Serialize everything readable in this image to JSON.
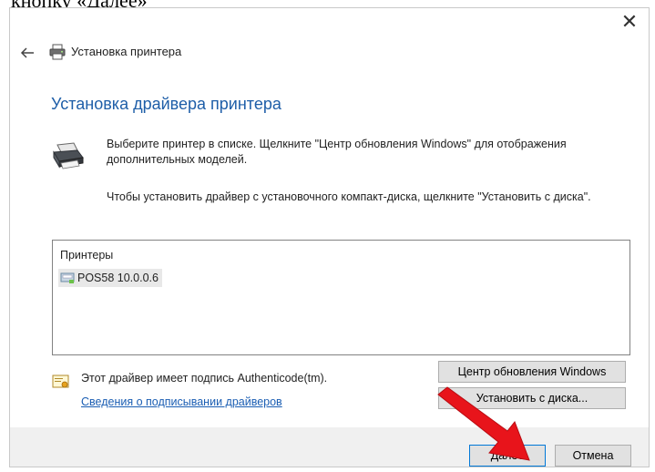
{
  "caption": {
    "text": "кнопку «Далее»"
  },
  "window": {
    "close_label": "✕",
    "back_label": "←",
    "header_title": "Установка принтера",
    "page_title": "Установка драйвера принтера",
    "description_1": "Выберите принтер в списке. Щелкните \"Центр обновления Windows\" для отображения дополнительных моделей.",
    "description_2": "Чтобы установить драйвер с установочного компакт-диска, щелкните \"Установить с диска\"."
  },
  "printer_list": {
    "header": "Принтеры",
    "items": [
      {
        "label": "POS58 10.0.0.6",
        "selected": true
      }
    ]
  },
  "signature": {
    "text": "Этот драйвер имеет подпись Authenticode(tm).",
    "link": "Сведения о подписывании драйверов"
  },
  "buttons": {
    "windows_update": "Центр обновления Windows",
    "have_disk": "Установить с диска...",
    "next": "Далее",
    "cancel": "Отмена"
  },
  "icons": {
    "back": "back-arrow-icon",
    "printer": "printer-icon",
    "certificate": "certificate-icon",
    "annotation": "red-arrow-icon"
  },
  "colors": {
    "title_blue": "#1e5ea8",
    "link_blue": "#1b5eb3",
    "button_bg": "#e1e1e1",
    "footer_bg": "#f0f0f0",
    "annotation_red": "#e8141b"
  }
}
